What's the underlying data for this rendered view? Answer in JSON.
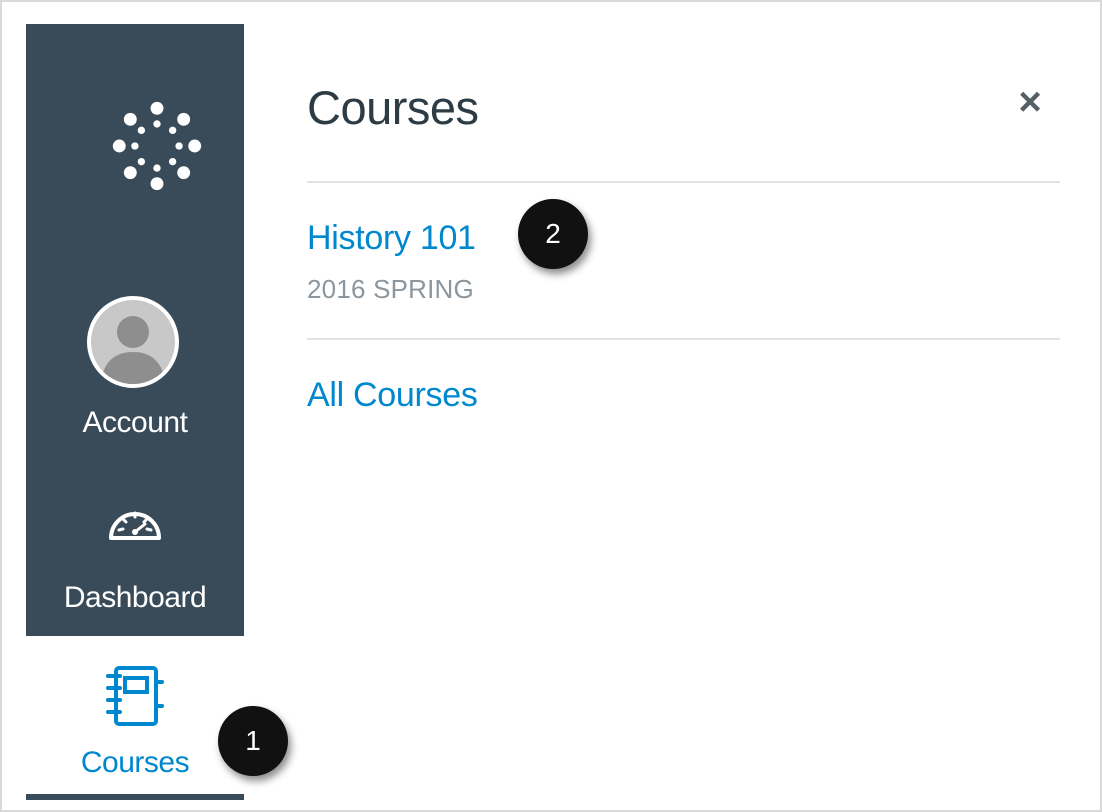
{
  "nav": {
    "account_label": "Account",
    "dashboard_label": "Dashboard",
    "courses_label": "Courses",
    "background_color": "#394b58",
    "active_color": "#0088cf",
    "icons": [
      "canvas-logo-icon",
      "avatar-icon",
      "dashboard-gauge-icon",
      "courses-notebook-icon"
    ]
  },
  "tray": {
    "title": "Courses",
    "close_symbol": "×",
    "courses": [
      {
        "name": "History 101",
        "term": "2016 SPRING"
      }
    ],
    "all_courses_label": "All Courses",
    "link_color": "#0088cf"
  },
  "callouts": {
    "step1": "1",
    "step2": "2"
  }
}
